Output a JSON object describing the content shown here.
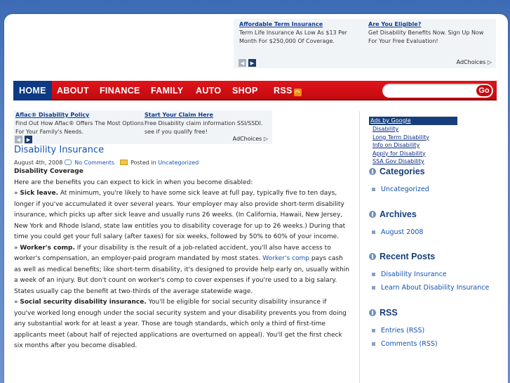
{
  "top_ads": {
    "ads": [
      {
        "title": "Affordable Term Insurance",
        "desc": "Term Life Insurance As Low As $13 Per Month For $250,000 Of Coverage."
      },
      {
        "title": "Are You Eligible?",
        "desc": "Get Disability Benefits Now. Sign Up Now For Your Free Evaluation!"
      }
    ],
    "adchoices": "AdChoices"
  },
  "nav": {
    "items": [
      "HOME",
      "ABOUT",
      "FINANCE",
      "FAMILY",
      "AUTO",
      "SHOP",
      "RSS"
    ],
    "search_placeholder": "",
    "go_label": "Go"
  },
  "mid_ads": {
    "ads": [
      {
        "title": "Aflac® Disability Policy",
        "desc": "Find Out How Aflac® Offers The Most Options For Your Family's Needs."
      },
      {
        "title": "Start Your Claim Here",
        "desc": "Free Disability claim information SSI/SSDI. see if you qualify free!"
      }
    ],
    "adchoices": "AdChoices"
  },
  "post": {
    "title": "Disability Insurance",
    "date": "August 4th, 2008",
    "comments": "No Comments",
    "posted_in": "Posted in",
    "category": "Uncategorized",
    "section_head": "Disability Coverage",
    "intro": "Here are the benefits you can expect to kick in when you become disabled:",
    "items": [
      {
        "lead": "» ",
        "bold": "Sick leave.",
        "text": " At minimum, you're likely to have some sick leave at full pay, typically five to ten days, longer if you've accumulated it over several years. Your employer may also provide short-term disability insurance, which picks up after sick leave and usually runs 26 weeks. (In California, Hawaii, New Jersey, New York and Rhode Island, state law entitles you to disability coverage for up to 26 weeks.) During that time you could get your full salary (after taxes) for six weeks, followed by 50% to 60% of your income."
      },
      {
        "lead": "» ",
        "bold": "Worker's comp.",
        "text_a": " If your disability is the result of a job-related accident, you'll also have access to worker's compensation, an employer-paid program mandated by most states. ",
        "link": "Worker's comp",
        "text_b": " pays cash as well as medical benefits; like short-term disability, it's designed to provide help early on, usually within a week of an injury. But don't count on worker's comp to cover expenses if you're used to a big salary. States usually cap the benefit at two-thirds of the average statewide wage."
      },
      {
        "lead": "» ",
        "bold": "Social security disability insurance.",
        "text": " You'll be eligible for social security disability insurance if you've worked long enough under the social security system and your disability prevents you from doing any substantial work for at least a year. Those are tough standards, which only a third of first-time applicants meet (about half of rejected applications are overturned on appeal). You'll get the first check six months after you become disabled."
      }
    ]
  },
  "sidebar": {
    "ads_title": "Ads by Google",
    "ads_links": [
      "Disability",
      "Long Term Disability",
      "Info on Disability",
      "Apply for Disability",
      "SSA Gov Disability"
    ],
    "widgets": [
      {
        "title": "Categories",
        "items": [
          "Uncategorized"
        ]
      },
      {
        "title": "Archives",
        "items": [
          "August 2008"
        ]
      },
      {
        "title": "Recent Posts",
        "items": [
          "Disability Insurance",
          "Learn About Disability Insurance"
        ]
      },
      {
        "title": "RSS",
        "items": [
          "Entries (RSS)",
          "Comments (RSS)"
        ]
      }
    ]
  }
}
